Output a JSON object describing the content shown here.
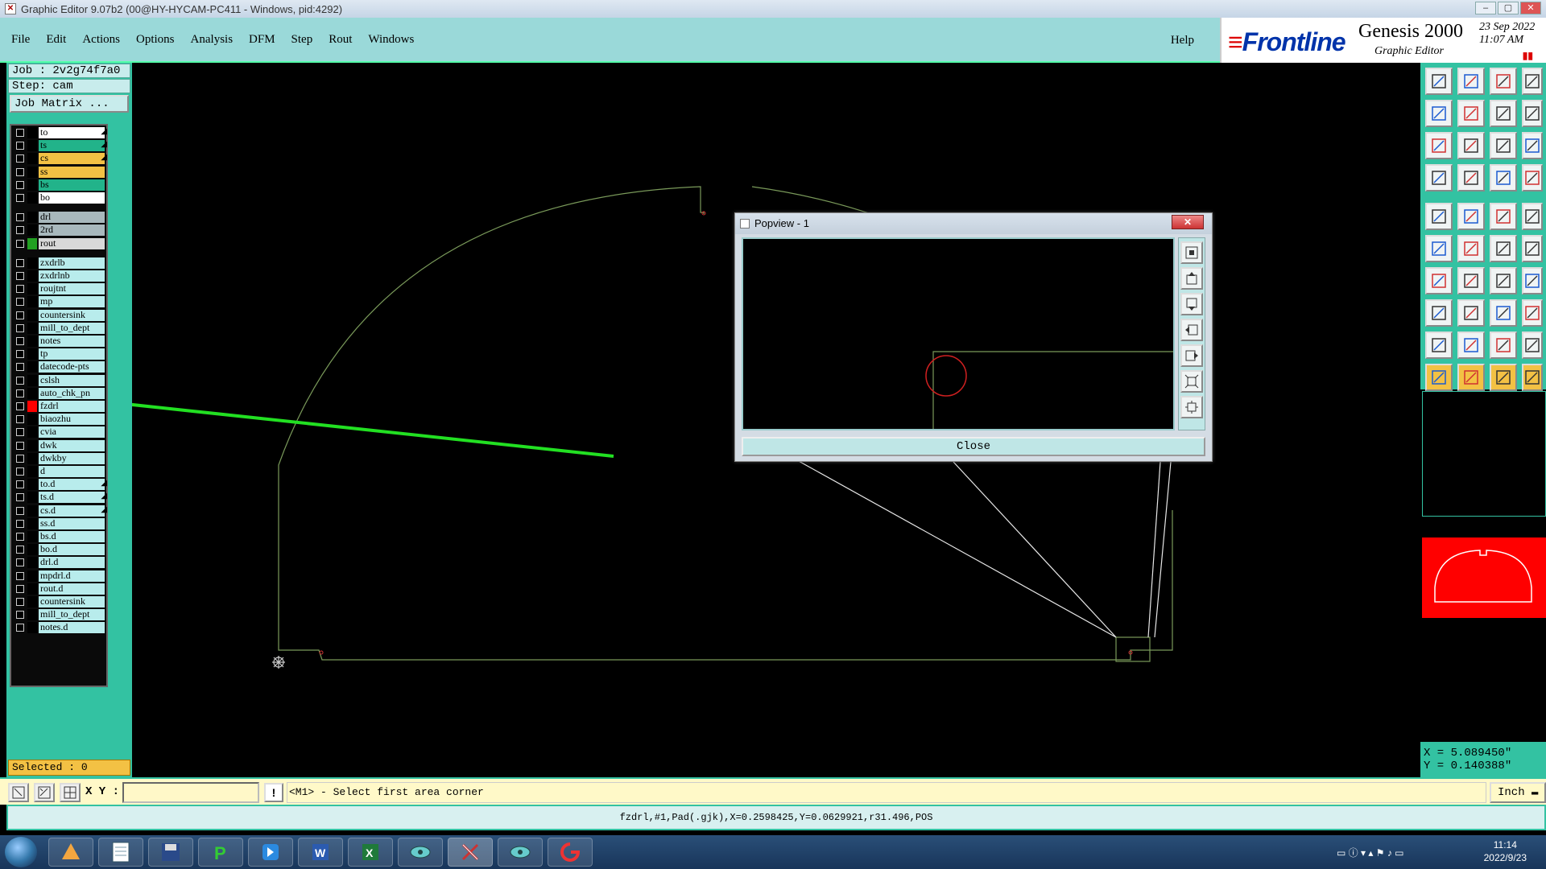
{
  "window": {
    "title": "Graphic Editor 9.07b2 (00@HY-HYCAM-PC411 - Windows, pid:4292)"
  },
  "menu": {
    "items": [
      "File",
      "Edit",
      "Actions",
      "Options",
      "Analysis",
      "DFM",
      "Step",
      "Rout",
      "Windows"
    ],
    "help": "Help"
  },
  "brand": {
    "logo": "Frontline",
    "product": "Genesis 2000",
    "subtitle": "Graphic Editor",
    "date": "23 Sep 2022",
    "time": "11:07 AM"
  },
  "job": {
    "job_line": "Job : 2v2g74f7a0",
    "step_line": "Step: cam",
    "matrix_button": "Job Matrix ..."
  },
  "layers": [
    {
      "name": "to",
      "color": "#ffffff",
      "mark": "◢"
    },
    {
      "name": "ts",
      "color": "#22b38a",
      "mark": "◢"
    },
    {
      "name": "cs",
      "color": "#f3c144",
      "mark": "◢"
    },
    {
      "name": "ss",
      "color": "#f3c144",
      "mark": ""
    },
    {
      "name": "bs",
      "color": "#22b38a",
      "mark": ""
    },
    {
      "name": "bo",
      "color": "#ffffff",
      "mark": ""
    },
    {
      "name": "drl",
      "color": "#a8b8bc",
      "mark": ""
    },
    {
      "name": "2rd",
      "color": "#a8b8bc",
      "mark": ""
    },
    {
      "name": "rout",
      "color": "#d8d8d8",
      "mark": ""
    },
    {
      "name": "zxdrlb",
      "color": "#b8ecec",
      "mark": ""
    },
    {
      "name": "zxdrlnb",
      "color": "#b8ecec",
      "mark": ""
    },
    {
      "name": "roujtnt",
      "color": "#b8ecec",
      "mark": ""
    },
    {
      "name": "mp",
      "color": "#b8ecec",
      "mark": ""
    },
    {
      "name": "countersink",
      "color": "#b8ecec",
      "mark": ""
    },
    {
      "name": "mill_to_dept",
      "color": "#b8ecec",
      "mark": ""
    },
    {
      "name": "notes",
      "color": "#b8ecec",
      "mark": ""
    },
    {
      "name": "tp",
      "color": "#b8ecec",
      "mark": ""
    },
    {
      "name": "datecode-pts",
      "color": "#b8ecec",
      "mark": ""
    },
    {
      "name": "cslsh",
      "color": "#b8ecec",
      "mark": ""
    },
    {
      "name": "auto_chk_pn",
      "color": "#b8ecec",
      "mark": ""
    },
    {
      "name": "fzdrl",
      "color": "#b8ecec",
      "mark": ""
    },
    {
      "name": "biaozhu",
      "color": "#b8ecec",
      "mark": ""
    },
    {
      "name": "cvia",
      "color": "#b8ecec",
      "mark": ""
    },
    {
      "name": "dwk",
      "color": "#b8ecec",
      "mark": ""
    },
    {
      "name": "dwkby",
      "color": "#b8ecec",
      "mark": ""
    },
    {
      "name": "d",
      "color": "#b8ecec",
      "mark": ""
    },
    {
      "name": "to.d",
      "color": "#b8ecec",
      "mark": "◢"
    },
    {
      "name": "ts.d",
      "color": "#b8ecec",
      "mark": "◢"
    },
    {
      "name": "cs.d",
      "color": "#b8ecec",
      "mark": "◢"
    },
    {
      "name": "ss.d",
      "color": "#b8ecec",
      "mark": ""
    },
    {
      "name": "bs.d",
      "color": "#b8ecec",
      "mark": ""
    },
    {
      "name": "bo.d",
      "color": "#b8ecec",
      "mark": ""
    },
    {
      "name": "drl.d",
      "color": "#b8ecec",
      "mark": ""
    },
    {
      "name": "mpdrl.d",
      "color": "#b8ecec",
      "mark": ""
    },
    {
      "name": "rout.d",
      "color": "#b8ecec",
      "mark": ""
    },
    {
      "name": "countersink",
      "color": "#b8ecec",
      "mark": ""
    },
    {
      "name": "mill_to_dept",
      "color": "#b8ecec",
      "mark": ""
    },
    {
      "name": "notes.d",
      "color": "#b8ecec",
      "mark": ""
    }
  ],
  "selected": "Selected : 0",
  "popview": {
    "title": "Popview - 1",
    "close_label": "Close"
  },
  "coords": {
    "x": "X = 5.089450\"",
    "y": "Y = 0.140388\""
  },
  "command": {
    "xy_label": "X Y :",
    "xy_value": "",
    "prompt": "<M1> - Select first area corner",
    "units": "Inch"
  },
  "status": "fzdrl,#1,Pad(.gjk),X=0.2598425,Y=0.0629921,r31.496,POS",
  "taskbar": {
    "time": "11:14",
    "date": "2022/9/23"
  },
  "colors": {
    "accent": "#33c2a2",
    "menu_bg": "#9ad9d9",
    "profile_line": "#7a9a5a",
    "arrow": "#22e022",
    "highlight_red": "#ff0000"
  }
}
